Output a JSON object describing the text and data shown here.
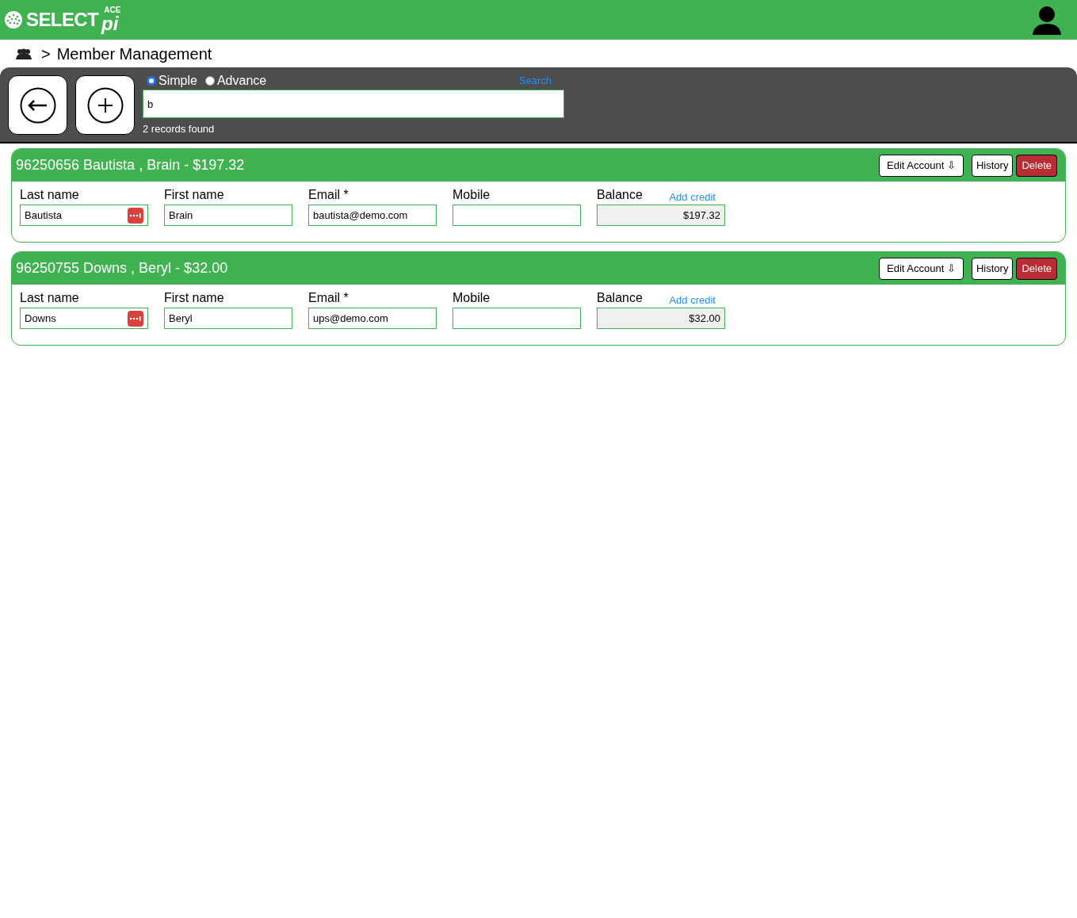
{
  "header": {
    "logo": {
      "brand": "SELECT",
      "suffix": "pi",
      "badge": "ACE"
    }
  },
  "breadcrumb": {
    "separator": ">",
    "title": "Member Management"
  },
  "search": {
    "modes": [
      {
        "label": "Simple",
        "selected": true
      },
      {
        "label": "Advance",
        "selected": false
      }
    ],
    "link": "Search",
    "value": "b",
    "result": "2 records found"
  },
  "members": [
    {
      "title": "96250656 Bautista , Brain - $197.32",
      "edit": "Edit Account ⇩",
      "history": "History",
      "delete": "Delete",
      "fields": [
        {
          "label": "Last name",
          "value": "Bautista",
          "kind": "menu"
        },
        {
          "label": "First name",
          "value": "Brain",
          "kind": "text"
        },
        {
          "label": "Email *",
          "value": "bautista@demo.com",
          "kind": "text"
        },
        {
          "label": "Mobile",
          "kind": "text"
        },
        {
          "label": "Balance",
          "value": "$197.32",
          "kind": "balance",
          "link": "Add credit"
        }
      ]
    },
    {
      "title": "96250755 Downs , Beryl - $32.00",
      "edit": "Edit Account ⇩",
      "history": "History",
      "delete": "Delete",
      "fields": [
        {
          "label": "Last name",
          "value": "Downs",
          "kind": "menu"
        },
        {
          "label": "First name",
          "value": "Beryl",
          "kind": "text"
        },
        {
          "label": "Email *",
          "value": "ups@demo.com",
          "kind": "text"
        },
        {
          "label": "Mobile",
          "kind": "text"
        },
        {
          "label": "Balance",
          "value": "$32.00",
          "kind": "balance",
          "link": "Add credit"
        }
      ]
    }
  ]
}
